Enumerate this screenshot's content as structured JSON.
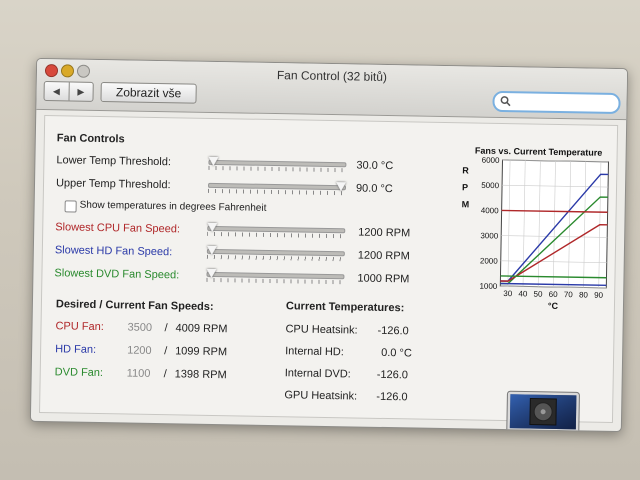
{
  "window": {
    "title": "Fan Control (32 bitů)",
    "show_all": "Zobrazit vše",
    "back": "◀",
    "forward": "▶"
  },
  "fan_controls": {
    "header": "Fan Controls",
    "lower": {
      "label": "Lower Temp Threshold:",
      "value": "30.0 °C"
    },
    "upper": {
      "label": "Upper Temp Threshold:",
      "value": "90.0 °C"
    },
    "fahrenheit": "Show temperatures in degrees Fahrenheit",
    "cpu": {
      "label": "Slowest CPU Fan Speed:",
      "value": "1200 RPM"
    },
    "hd": {
      "label": "Slowest HD Fan Speed:",
      "value": "1200 RPM"
    },
    "dvd": {
      "label": "Slowest DVD Fan Speed:",
      "value": "1000 RPM"
    }
  },
  "speeds": {
    "header": "Desired / Current Fan Speeds:",
    "cpu": {
      "label": "CPU Fan:",
      "desired": "3500",
      "sep": "/",
      "current": "4009 RPM"
    },
    "hd": {
      "label": "HD Fan:",
      "desired": "1200",
      "sep": "/",
      "current": "1099 RPM"
    },
    "dvd": {
      "label": "DVD Fan:",
      "desired": "1100",
      "sep": "/",
      "current": "1398 RPM"
    }
  },
  "temps": {
    "header": "Current Temperatures:",
    "cpu": {
      "label": "CPU Heatsink:",
      "value": "-126.0"
    },
    "hd": {
      "label": "Internal HD:",
      "value": "0.0 °C"
    },
    "dvd": {
      "label": "Internal DVD:",
      "value": "-126.0"
    },
    "gpu": {
      "label": "GPU Heatsink:",
      "value": "-126.0"
    }
  },
  "colors": {
    "cpu": "#b0282a",
    "hd": "#2b3aa8",
    "dvd": "#2a8a2e"
  },
  "chart_data": {
    "type": "line",
    "title": "Fans vs. Current Temperature",
    "ylabel_letters": [
      "R",
      "P",
      "M"
    ],
    "xlabel": "°C",
    "xlim": [
      25,
      95
    ],
    "ylim": [
      1000,
      6000
    ],
    "xticks": [
      30,
      40,
      50,
      60,
      70,
      80,
      90
    ],
    "yticks": [
      1000,
      2000,
      3000,
      4000,
      5000,
      6000
    ],
    "series": [
      {
        "color": "#2b3aa8",
        "x": [
          25,
          30,
          90,
          95
        ],
        "y": [
          1200,
          1200,
          5500,
          5500
        ]
      },
      {
        "color": "#2a8a2e",
        "x": [
          25,
          30,
          90,
          95
        ],
        "y": [
          1100,
          1100,
          4600,
          4600
        ]
      },
      {
        "color": "#b0282a",
        "x": [
          25,
          30,
          90,
          95
        ],
        "y": [
          1200,
          1200,
          3500,
          3500
        ]
      },
      {
        "color": "#b0282a",
        "x": [
          25,
          95
        ],
        "y": [
          4000,
          4000
        ]
      },
      {
        "color": "#2b3aa8",
        "x": [
          25,
          95
        ],
        "y": [
          1100,
          1100
        ]
      },
      {
        "color": "#2a8a2e",
        "x": [
          25,
          95
        ],
        "y": [
          1400,
          1400
        ]
      }
    ]
  }
}
